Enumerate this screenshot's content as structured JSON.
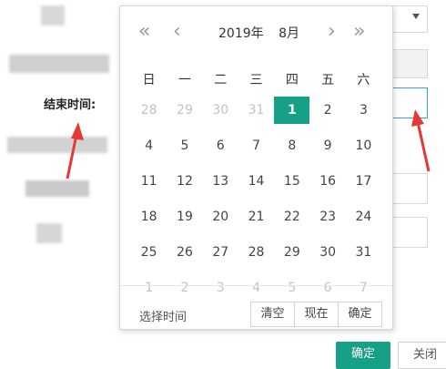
{
  "form": {
    "end_time_label": "结束时间:",
    "confirm_label": "确定",
    "close_label": "关闭"
  },
  "calendar": {
    "nav": {
      "prev_year": "«",
      "prev_month": "‹",
      "next_month": "›",
      "next_year": "»"
    },
    "year": "2019年",
    "month": "8月",
    "weekdays": [
      "日",
      "一",
      "二",
      "三",
      "四",
      "五",
      "六"
    ],
    "weeks": [
      [
        {
          "d": "28",
          "o": true
        },
        {
          "d": "29",
          "o": true
        },
        {
          "d": "30",
          "o": true
        },
        {
          "d": "31",
          "o": true
        },
        {
          "d": "1",
          "s": true
        },
        {
          "d": "2"
        },
        {
          "d": "3"
        }
      ],
      [
        {
          "d": "4"
        },
        {
          "d": "5"
        },
        {
          "d": "6"
        },
        {
          "d": "7"
        },
        {
          "d": "8"
        },
        {
          "d": "9"
        },
        {
          "d": "10"
        }
      ],
      [
        {
          "d": "11"
        },
        {
          "d": "12"
        },
        {
          "d": "13"
        },
        {
          "d": "14"
        },
        {
          "d": "15"
        },
        {
          "d": "16"
        },
        {
          "d": "17"
        }
      ],
      [
        {
          "d": "18"
        },
        {
          "d": "19"
        },
        {
          "d": "20"
        },
        {
          "d": "21"
        },
        {
          "d": "22"
        },
        {
          "d": "23"
        },
        {
          "d": "24"
        }
      ],
      [
        {
          "d": "25"
        },
        {
          "d": "26"
        },
        {
          "d": "27"
        },
        {
          "d": "28"
        },
        {
          "d": "29"
        },
        {
          "d": "30"
        },
        {
          "d": "31"
        }
      ],
      [
        {
          "d": "1",
          "o": true
        },
        {
          "d": "2",
          "o": true
        },
        {
          "d": "3",
          "o": true
        },
        {
          "d": "4",
          "o": true
        },
        {
          "d": "5",
          "o": true
        },
        {
          "d": "6",
          "o": true
        },
        {
          "d": "7",
          "o": true
        }
      ]
    ],
    "footer": {
      "pick_time": "选择时间",
      "clear": "清空",
      "now": "现在",
      "ok": "确定"
    }
  },
  "colors": {
    "accent": "#16a085",
    "annotation_arrow": "#e53935",
    "focus_border": "#3aa0e0"
  }
}
